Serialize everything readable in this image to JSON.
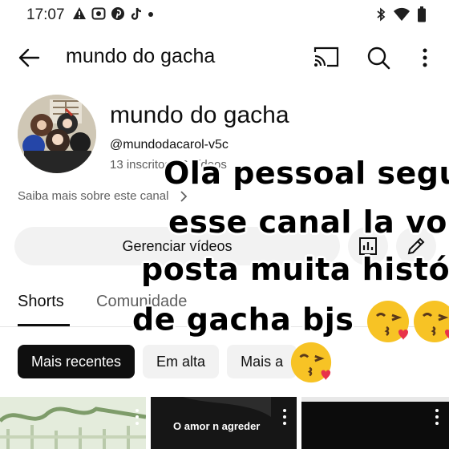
{
  "status_bar": {
    "time": "17:07",
    "left_icons": [
      "alert-icon",
      "screen-record-icon",
      "pinterest-icon",
      "tiktok-icon",
      "dot-icon"
    ],
    "right_icons": [
      "bluetooth-icon",
      "wifi-icon",
      "battery-icon"
    ]
  },
  "top_bar": {
    "title": "mundo do gacha",
    "icons": [
      "back-arrow-icon",
      "cast-icon",
      "search-icon",
      "more-vert-icon"
    ]
  },
  "channel": {
    "name": "mundo do gacha",
    "handle": "@mundodacarol-v5c",
    "stats": "13 inscritos · 6 vídeos",
    "more_about": "Saiba mais sobre este canal"
  },
  "actions": {
    "manage_videos": "Gerenciar vídeos",
    "icons": [
      "analytics-icon",
      "edit-pencil-icon"
    ]
  },
  "tabs": [
    {
      "label": "Shorts",
      "active": true
    },
    {
      "label": "Comunidade",
      "active": false
    }
  ],
  "chips": [
    {
      "label": "Mais recentes",
      "active": true
    },
    {
      "label": "Em alta",
      "active": false
    },
    {
      "label": "Mais a",
      "active": false
    }
  ],
  "thumbnails": [
    {
      "caption": ""
    },
    {
      "caption": "O amor n agreder"
    },
    {
      "caption": ""
    }
  ],
  "overlay_text": {
    "line1": "Ola pessoal segu",
    "line2": "esse canal la vou",
    "line3": "posta muita histór",
    "line4": "de gacha bjs",
    "emoji": "kiss-wink-emoji"
  },
  "colors": {
    "text_primary": "#0f0f0f",
    "text_secondary": "#606060",
    "chip_bg": "#f2f2f2",
    "chip_active_bg": "#0f0f0f",
    "emoji_yellow": "#f7c325",
    "heart_red": "#e8334a"
  }
}
